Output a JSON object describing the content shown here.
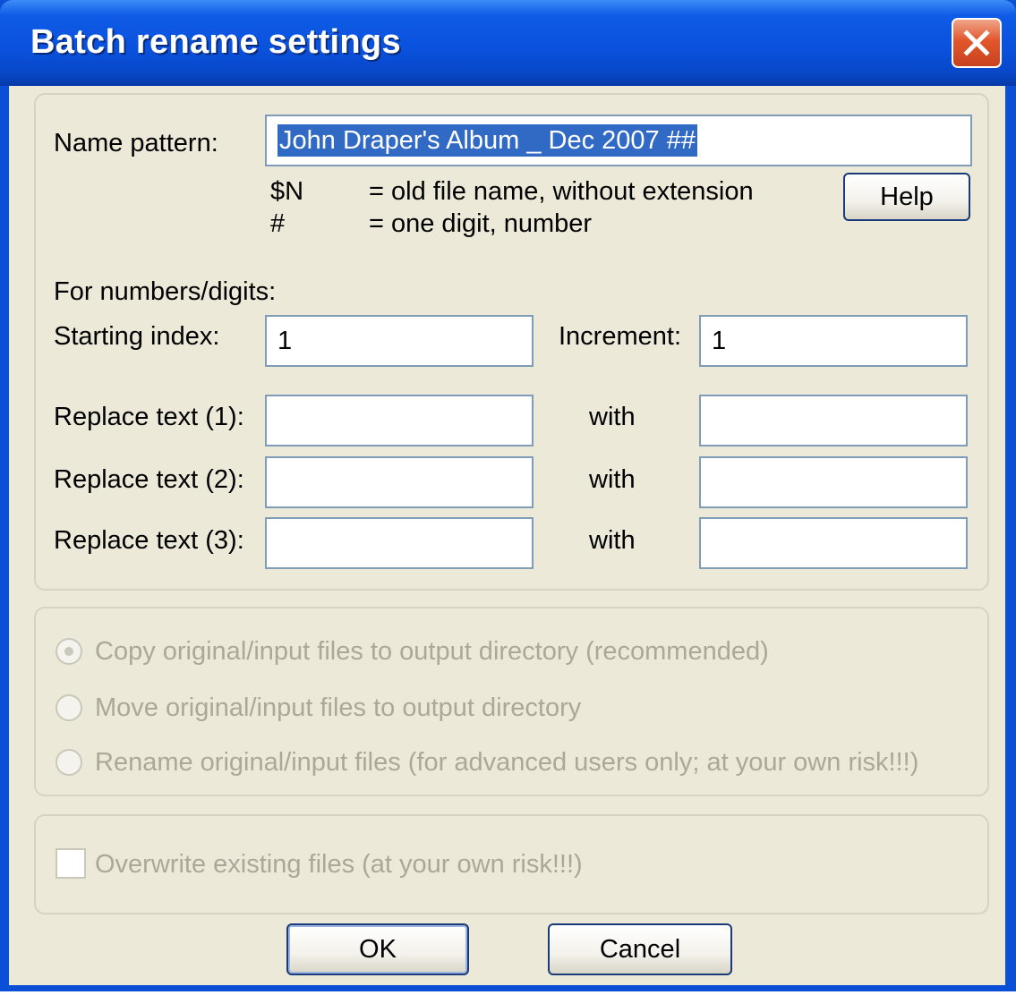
{
  "window": {
    "title": "Batch rename settings"
  },
  "name_pattern": {
    "label": "Name pattern:",
    "value": "John Draper's Album _ Dec 2007 ##",
    "help_label": "Help",
    "legend": [
      {
        "token": "$N",
        "desc": "= old file name, without extension"
      },
      {
        "token": "#",
        "desc": "= one digit, number"
      }
    ]
  },
  "numbers": {
    "section_label": "For numbers/digits:",
    "starting_index_label": "Starting index:",
    "starting_index_value": "1",
    "increment_label": "Increment:",
    "increment_value": "1"
  },
  "replace": [
    {
      "label": "Replace text (1):",
      "with_label": "with",
      "find": "",
      "replace": ""
    },
    {
      "label": "Replace text (2):",
      "with_label": "with",
      "find": "",
      "replace": ""
    },
    {
      "label": "Replace text (3):",
      "with_label": "with",
      "find": "",
      "replace": ""
    }
  ],
  "file_mode": {
    "options": [
      {
        "label": "Copy original/input files to output directory (recommended)",
        "selected": true
      },
      {
        "label": "Move original/input files to output directory",
        "selected": false
      },
      {
        "label": "Rename original/input files (for advanced users only; at your own risk!!!)",
        "selected": false
      }
    ],
    "enabled": false
  },
  "overwrite": {
    "label": "Overwrite existing files (at your own risk!!!)",
    "checked": false,
    "enabled": false
  },
  "buttons": {
    "ok": "OK",
    "cancel": "Cancel"
  },
  "colors": {
    "titlebar": "#0a52de",
    "dialog_bg": "#ece9d8",
    "selection": "#316ac5",
    "disabled_text": "#aca899"
  }
}
